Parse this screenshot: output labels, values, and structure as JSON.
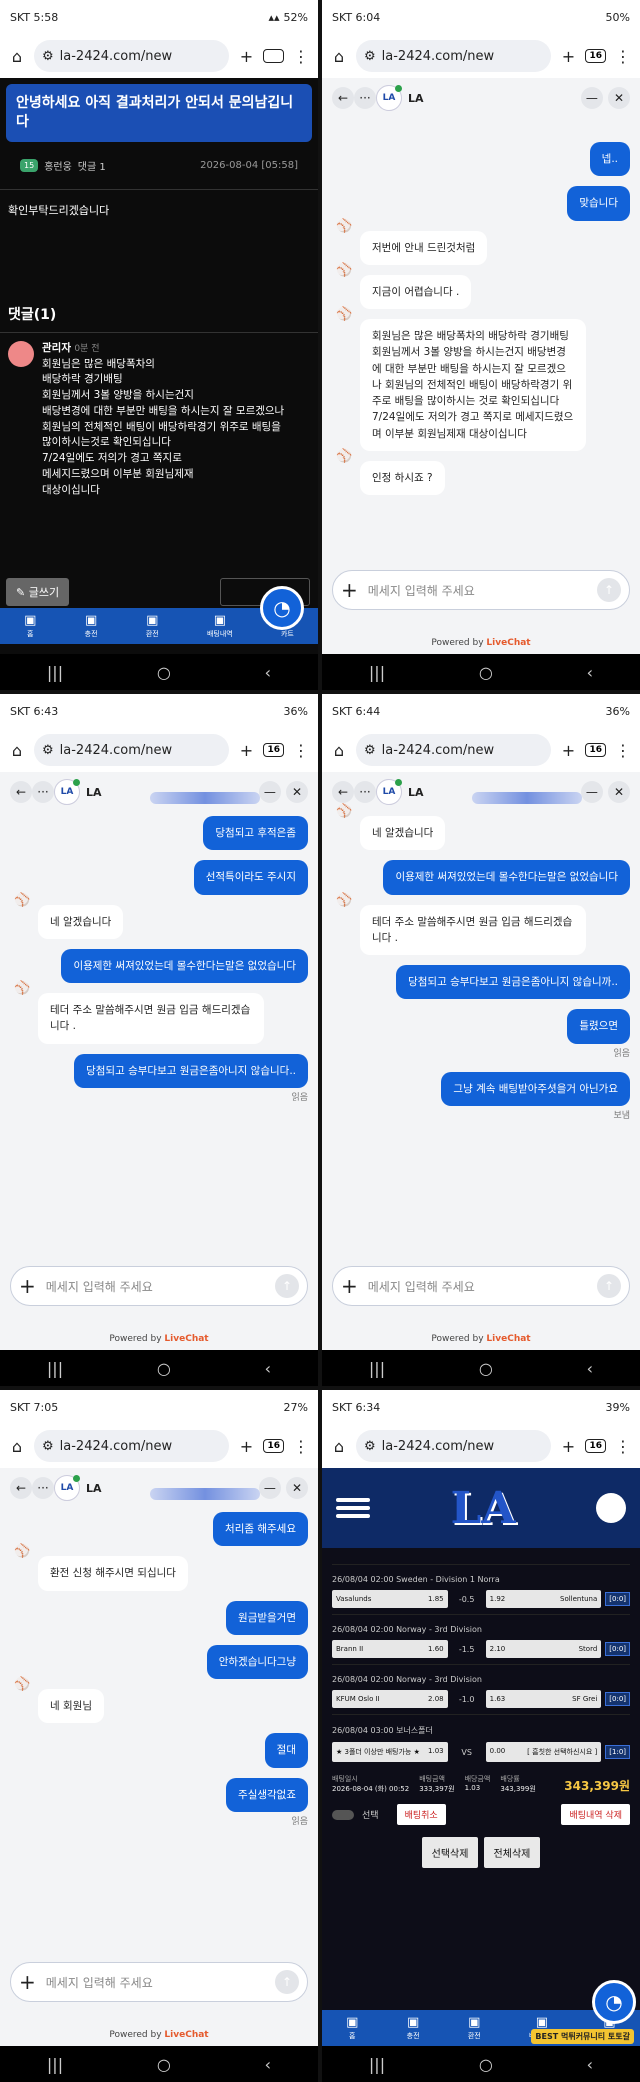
{
  "p1": {
    "carrier": "SKT 5:58",
    "battery": "52%",
    "url": "la-2424.com/new",
    "tabs": "16",
    "title": "안녕하세요 아직 결과처리가 안되서 문의남깁니다",
    "author_lvl": "15",
    "author": "홍런웅",
    "comment_count": "댓글 1",
    "date": "2026-08-04 [05:58]",
    "body": "확인부탁드리겠습니다",
    "comments_title": "댓글(1)",
    "reply_author": "관리자",
    "reply_time": "0분 전",
    "reply_lines": [
      "회원님은 많은 배당폭차의",
      "배당하락 경기배팅",
      "회원님께서 3볼 양방을 하시는건지",
      "배당변경에 대한 부분만 배팅을 하시는지 잘 모르겠으나",
      "회원님의 전체적인 배팅이 배당하락경기 위주로 배팅을",
      "많이하시는것로 확인되십니다",
      "7/24일에도 저의가 경고 쪽지로",
      "메세지드렸으며 이부분 회원님제재",
      "대상이십니다"
    ],
    "write_btn": "글쓰기",
    "bottom": [
      "홈",
      "충전",
      "환전",
      "배팅내역",
      "카트"
    ]
  },
  "p2": {
    "carrier": "SKT 6:04",
    "battery": "50%",
    "agent": "LA",
    "msgs": [
      {
        "w": "u",
        "t": "넵.."
      },
      {
        "w": "u",
        "t": "맞습니다"
      },
      {
        "w": "a",
        "t": "저번에 안내 드린것처럼"
      },
      {
        "w": "a",
        "t": "지금이 어렵습니다 ."
      },
      {
        "w": "a",
        "t": "회원님은 많은 배당폭차의 배당하락 경기배팅 회원님께서 3볼 양방을 하시는건지 배당변경에 대한 부분만 배팅을 하시는지 잘 모르겠으나 회원님의 전체적인 배팅이 배당하락경기 위주로 배팅을 많이하시는 것로 확인되십니다 7/24일에도 저의가 경고 쪽지로 메세지드렸으며 이부분 회원님제재 대상이십니다"
      },
      {
        "w": "a",
        "t": "인정 하시죠 ?"
      }
    ]
  },
  "p3": {
    "carrier": "SKT 6:43",
    "battery": "36%",
    "msgs": [
      {
        "w": "u",
        "t": "당첨되고 후적은좀"
      },
      {
        "w": "u",
        "t": "선적특이라도 주시지"
      },
      {
        "w": "a",
        "t": "네 알겠습니다"
      },
      {
        "w": "u",
        "t": "이용제한 써져있었는데 몰수한다는말은 없었습니다"
      },
      {
        "w": "a",
        "t": "테더 주소 말씀해주시면 원금 입금 해드리겠습니다 ."
      },
      {
        "w": "u",
        "t": "당첨되고 승부다보고 원금은좀아니지 않습니다.."
      }
    ],
    "status": "읽음"
  },
  "p4": {
    "carrier": "SKT 6:44",
    "battery": "36%",
    "msgs": [
      {
        "w": "a",
        "t": "네 알겠습니다"
      },
      {
        "w": "u",
        "t": "이용제한 써져있었는데 몰수한다는말은 없었습니다"
      },
      {
        "w": "a",
        "t": "테더 주소 말씀해주시면 원금 입금 해드리겠습니다 ."
      },
      {
        "w": "u",
        "t": "당첨되고 승부다보고 원금은좀아니지 않습니까.."
      },
      {
        "w": "u",
        "t": "틀렸으면"
      }
    ],
    "status1": "읽음",
    "last": "그냥 계속 배팅받아주셧을거 아닌가요",
    "status2": "보냄"
  },
  "p5": {
    "carrier": "SKT 7:05",
    "battery": "27%",
    "msgs": [
      {
        "w": "u",
        "t": "처리좀 해주세요"
      },
      {
        "w": "a",
        "t": "환전 신청 해주시면 되십니다"
      },
      {
        "w": "u",
        "t": "원금받을거면"
      },
      {
        "w": "u",
        "t": "안하겠습니다그냥"
      },
      {
        "w": "a",
        "t": "네 회원님"
      },
      {
        "w": "u",
        "t": "절대"
      },
      {
        "w": "u",
        "t": "주실생각없죠"
      }
    ],
    "status": "읽음"
  },
  "p6": {
    "carrier": "SKT 6:34",
    "battery": "39%",
    "games": [
      {
        "head": "26/08/04 02:00 Sweden - Division 1 Norra",
        "home": "Vasalunds",
        "ho": "1.85",
        "hc": "-0.5",
        "ao": "1.92",
        "away": "Sollentuna",
        "score": "[0:0]"
      },
      {
        "head": "26/08/04 02:00 Norway - 3rd Division",
        "home": "Brann II",
        "ho": "1.60",
        "hc": "-1.5",
        "ao": "2.10",
        "away": "Stord",
        "score": "[0:0]"
      },
      {
        "head": "26/08/04 02:00 Norway - 3rd Division",
        "home": "KFUM Oslo II",
        "ho": "2.08",
        "hc": "-1.0",
        "ao": "1.63",
        "away": "SF Grei",
        "score": "[0:0]"
      },
      {
        "head": "26/08/04 03:00 보너스폴더",
        "home": "★ 3폴더 이상만 배팅가능 ★",
        "ho": "1.03",
        "hc": "VS",
        "ao": "0.00",
        "away": "[ 흠칫한 선택하신시요 ]",
        "score": "[1:0]"
      }
    ],
    "bet_labels": [
      "배팅일시",
      "배팅금액",
      "배당금액",
      "배당률",
      "당첨금"
    ],
    "bet_vals": [
      "2026-08-04 (화) 00:52",
      "333,397원",
      "1.03",
      "343,399원"
    ],
    "win": "343,399원",
    "sel": "선택",
    "cancel": "배팅취소",
    "del_hist": "배팅내역 삭제",
    "del_sel": "선택삭제",
    "del_all": "전체삭제",
    "watermark": "BEST 먹튀커뮤니티 토토갈"
  },
  "common": {
    "input_ph": "메세지 입력해 주세요",
    "powered": "Powered by",
    "brand": "LiveChat"
  }
}
